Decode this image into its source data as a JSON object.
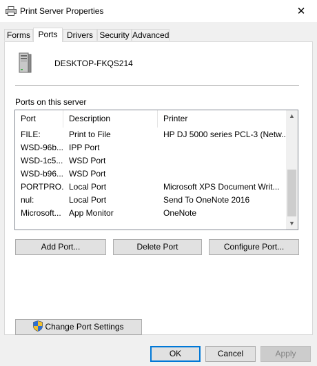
{
  "window": {
    "title": "Print Server Properties",
    "close_glyph": "✕"
  },
  "tabs": [
    {
      "label": "Forms"
    },
    {
      "label": "Ports"
    },
    {
      "label": "Drivers"
    },
    {
      "label": "Security"
    },
    {
      "label": "Advanced"
    }
  ],
  "active_tab": "Ports",
  "server": {
    "name": "DESKTOP-FKQS214",
    "icon": "computer-tower-icon"
  },
  "ports_label": "Ports on this server",
  "columns": {
    "port": "Port",
    "description": "Description",
    "printer": "Printer"
  },
  "rows": [
    {
      "port": "FILE:",
      "description": "Print to File",
      "printer": "HP DJ 5000 series PCL-3 (Netw..."
    },
    {
      "port": "WSD-96b...",
      "description": "IPP Port",
      "printer": ""
    },
    {
      "port": "WSD-1c5...",
      "description": "WSD Port",
      "printer": ""
    },
    {
      "port": "WSD-b96...",
      "description": "WSD Port",
      "printer": ""
    },
    {
      "port": "PORTPRO...",
      "description": "Local Port",
      "printer": "Microsoft XPS Document Writ..."
    },
    {
      "port": "nul:",
      "description": "Local Port",
      "printer": "Send To OneNote 2016"
    },
    {
      "port": "Microsoft...",
      "description": "App Monitor",
      "printer": "OneNote"
    }
  ],
  "buttons": {
    "add_port": "Add Port...",
    "delete_port": "Delete Port",
    "configure_port": "Configure Port...",
    "change_port_settings": "Change Port Settings",
    "ok": "OK",
    "cancel": "Cancel",
    "apply": "Apply"
  },
  "scrollbar": {
    "up": "▲",
    "down": "▼"
  }
}
